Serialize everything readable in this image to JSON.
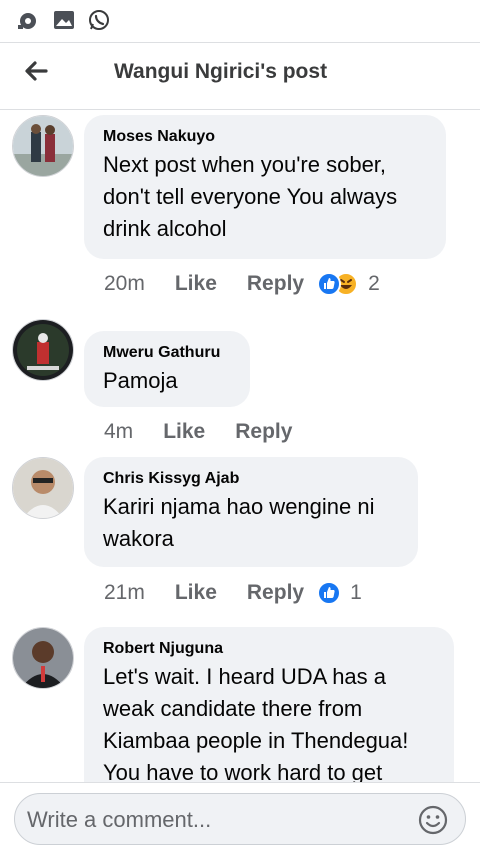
{
  "status_icons": [
    "app-notification-icon",
    "gallery-icon",
    "whatsapp-icon"
  ],
  "header": {
    "title": "Wangui Ngirici's post"
  },
  "comments": [
    {
      "name": "Moses Nakuyo",
      "text": "Next post when you're sober, don't tell everyone You always drink alcohol",
      "time": "20m",
      "like": "Like",
      "reply": "Reply",
      "reactions": [
        "like",
        "haha"
      ],
      "reaction_count": "2"
    },
    {
      "name": "Mweru Gathuru",
      "text": "Pamoja",
      "time": "4m",
      "like": "Like",
      "reply": "Reply"
    },
    {
      "name": "Chris Kissyg Ajab",
      "text": "Kariri njama hao wengine ni wakora",
      "time": "21m",
      "like": "Like",
      "reply": "Reply",
      "reactions": [
        "like"
      ],
      "reaction_count": "1"
    },
    {
      "name": "Robert Njuguna",
      "text": "Let's wait. I heard UDA has a weak candidate there from Kiambaa people in Thendegua! You have to work hard to get"
    }
  ],
  "composer": {
    "placeholder": "Write a comment..."
  },
  "colors": {
    "like_blue": "#1877f2",
    "haha_yellow": "#f7b125",
    "meta_gray": "#65676b",
    "bubble_bg": "#f0f2f5"
  }
}
